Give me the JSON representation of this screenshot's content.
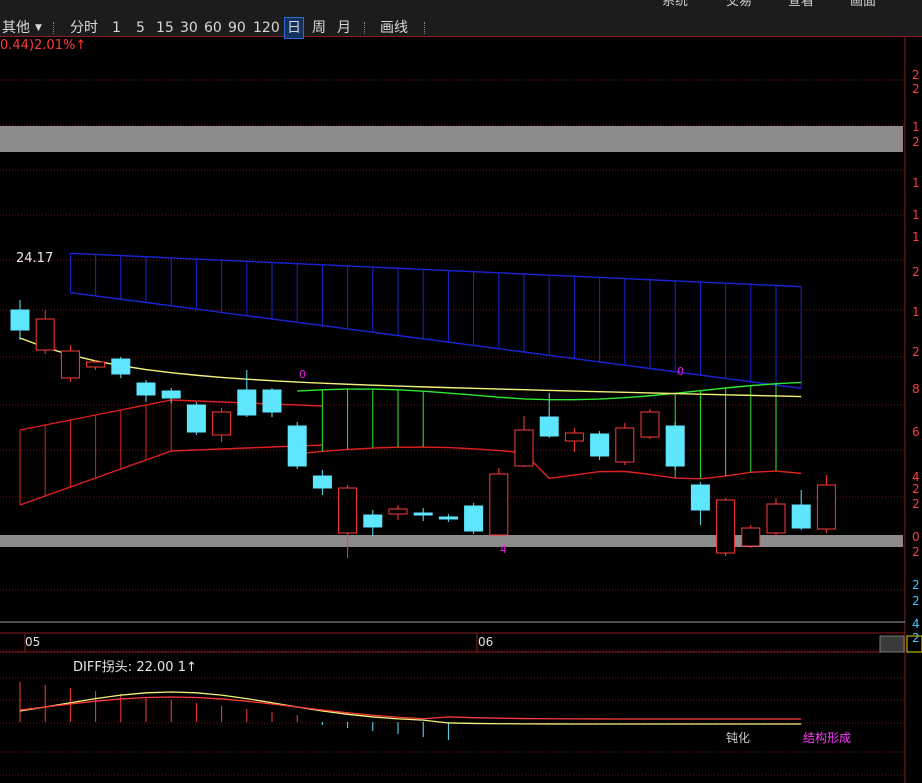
{
  "toolbar": {
    "other_label": "其他",
    "dropdown_icon": "caret-down-icon",
    "items": [
      "分时",
      "1",
      "5",
      "15",
      "30",
      "60",
      "90",
      "120",
      "日",
      "周",
      "月"
    ],
    "active_item": "日",
    "draw_label": "画线",
    "top_menu": [
      "系统",
      "交易",
      "查看",
      "画面"
    ]
  },
  "header": {
    "change_text": "0.44)2.01%↑"
  },
  "price_label": "24.17",
  "markers": {
    "m1": "0",
    "m2": "0",
    "m3": "4"
  },
  "dates": {
    "d1": "05",
    "d2": "06"
  },
  "right_axis": [
    "2",
    "2",
    "1",
    "2",
    "1",
    "1",
    "1",
    "2",
    "1",
    "2",
    "8",
    "6",
    "4",
    "2",
    "2",
    "0",
    "2",
    "2",
    "2",
    "4",
    "2"
  ],
  "indicator": {
    "label": "DIFF拐头:",
    "value": "22.00",
    "suffix": "1↑",
    "dunhua": "钝化",
    "jiegou": "结构形成"
  },
  "colors": {
    "up": "#ff3a3a",
    "down": "#5ee6ff",
    "upper_band": "#1a24d6",
    "lower_band_green": "#2ee82e",
    "lower_band_red": "#e02020",
    "ma_yellow": "#f2f27a",
    "gray_zone": "#8c8c8c"
  },
  "chart_data": {
    "type": "candlestick",
    "candles": [
      {
        "o": 140,
        "c": 120,
        "h": 150,
        "l": 110
      },
      {
        "o": 100,
        "c": 131,
        "h": 140,
        "l": 96
      },
      {
        "o": 72,
        "c": 99,
        "h": 105,
        "l": 68
      },
      {
        "o": 83,
        "c": 88,
        "h": 90,
        "l": 80
      },
      {
        "o": 91,
        "c": 76,
        "h": 93,
        "l": 72
      },
      {
        "o": 67,
        "c": 55,
        "h": 70,
        "l": 48
      },
      {
        "o": 59,
        "c": 52,
        "h": 62,
        "l": 47
      },
      {
        "o": 45,
        "c": 18,
        "h": 48,
        "l": 15
      },
      {
        "o": 15,
        "c": 38,
        "h": 42,
        "l": 8
      },
      {
        "o": 60,
        "c": 35,
        "h": 80,
        "l": 33
      },
      {
        "o": 60,
        "c": 38,
        "h": 62,
        "l": 33
      },
      {
        "o": 24,
        "c": -16,
        "h": 28,
        "l": -19
      },
      {
        "o": -26,
        "c": -38,
        "h": -20,
        "l": -45
      },
      {
        "o": -83,
        "c": -38,
        "h": -35,
        "l": -108
      },
      {
        "o": -65,
        "c": -77,
        "h": -60,
        "l": -86
      },
      {
        "o": -64,
        "c": -59,
        "h": -55,
        "l": -70
      },
      {
        "o": -63,
        "c": -65,
        "h": -58,
        "l": -71
      },
      {
        "o": -67,
        "c": -69,
        "h": -64,
        "l": -72
      },
      {
        "o": -56,
        "c": -81,
        "h": -53,
        "l": -84
      },
      {
        "o": -85,
        "c": -24,
        "h": -18,
        "l": -86
      },
      {
        "o": -16,
        "c": 20,
        "h": 34,
        "l": -17
      },
      {
        "o": 33,
        "c": 14,
        "h": 57,
        "l": 12
      },
      {
        "o": 9,
        "c": 17,
        "h": 22,
        "l": -2
      },
      {
        "o": 16,
        "c": -6,
        "h": 19,
        "l": -10
      },
      {
        "o": -12,
        "c": 22,
        "h": 27,
        "l": -15
      },
      {
        "o": 13,
        "c": 38,
        "h": 41,
        "l": 11
      },
      {
        "o": 24,
        "c": -16,
        "h": 28,
        "l": -20
      },
      {
        "o": -35,
        "c": -60,
        "h": -32,
        "l": -75
      },
      {
        "o": -103,
        "c": -50,
        "h": -48,
        "l": -106
      },
      {
        "o": -96,
        "c": -78,
        "h": -75,
        "l": -98
      },
      {
        "o": -83,
        "c": -54,
        "h": -48,
        "l": -87
      },
      {
        "o": -55,
        "c": -78,
        "h": -40,
        "l": -80
      },
      {
        "o": -79,
        "c": -35,
        "h": -25,
        "l": -83
      }
    ]
  }
}
